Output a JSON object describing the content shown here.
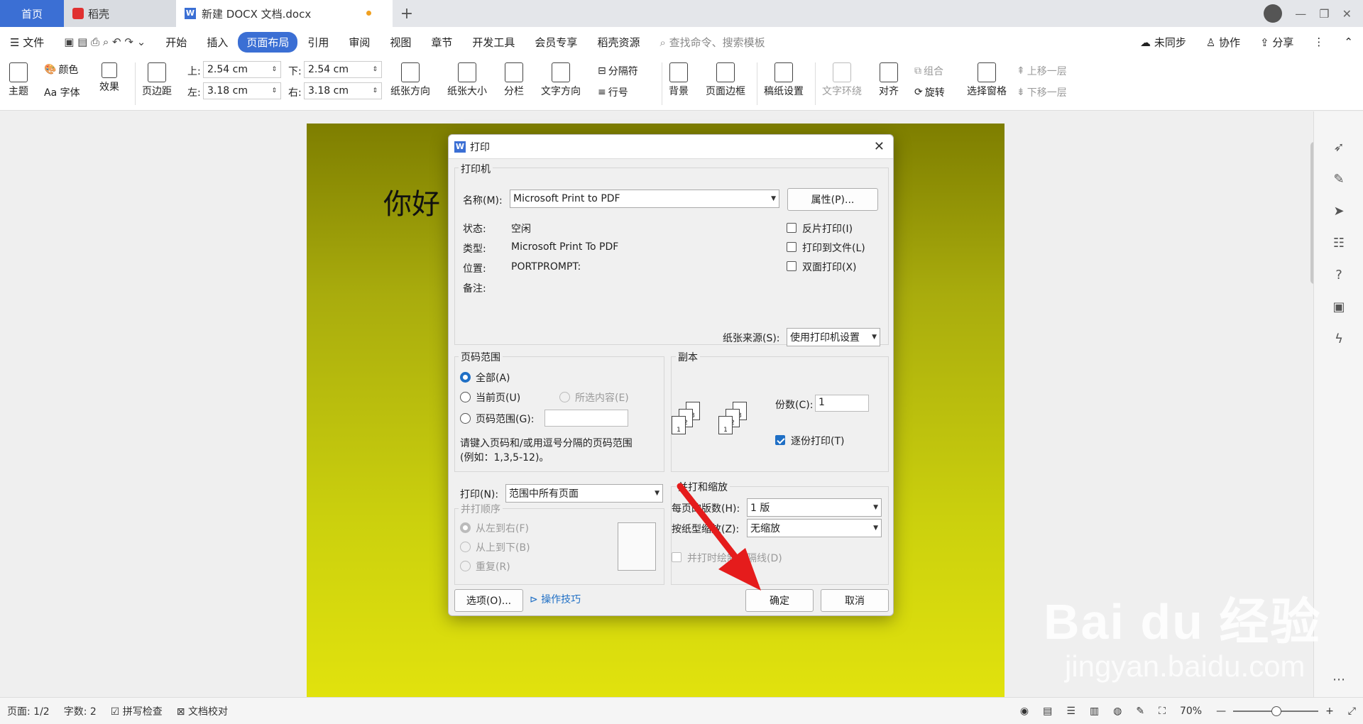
{
  "tabs": {
    "home": "首页",
    "daoke": "稻壳",
    "doc": "新建 DOCX 文档.docx",
    "plus": "+"
  },
  "menu": {
    "file": "文件",
    "items": [
      "开始",
      "插入",
      "页面布局",
      "引用",
      "审阅",
      "视图",
      "章节",
      "开发工具",
      "会员专享",
      "稻壳资源"
    ],
    "search": "查找命令、搜索模板",
    "sync": "未同步",
    "collab": "协作",
    "share": "分享"
  },
  "ribbon": {
    "theme": "主题",
    "color": "颜色",
    "font": "Aa 字体",
    "effect": "效果",
    "margin": "页边距",
    "top_label": "上:",
    "top_val": "2.54 cm",
    "bottom_label": "下:",
    "bottom_val": "2.54 cm",
    "left_label": "左:",
    "left_val": "3.18 cm",
    "right_label": "右:",
    "right_val": "3.18 cm",
    "orientation": "纸张方向",
    "size": "纸张大小",
    "columns": "分栏",
    "text_dir": "文字方向",
    "separator": "分隔符",
    "line_no": "行号",
    "background": "背景",
    "page_border": "页面边框",
    "draft": "稿纸设置",
    "wrap": "文字环绕",
    "align": "对齐",
    "group": "组合",
    "rotate": "旋转",
    "select_pane": "选择窗格",
    "up_layer": "上移一层",
    "down_layer": "下移一层"
  },
  "doc": {
    "text": "你好"
  },
  "dialog": {
    "title": "打印",
    "printer_group": "打印机",
    "name_label": "名称(M):",
    "name_val": "Microsoft Print to PDF",
    "props_btn": "属性(P)...",
    "status_label": "状态:",
    "status_val": "空闲",
    "type_label": "类型:",
    "type_val": "Microsoft Print To PDF",
    "loc_label": "位置:",
    "loc_val": "PORTPROMPT:",
    "note_label": "备注:",
    "reverse": "反片打印(I)",
    "to_file": "打印到文件(L)",
    "duplex": "双面打印(X)",
    "source_label": "纸张来源(S):",
    "source_val": "使用打印机设置",
    "range_group": "页码范围",
    "all": "全部(A)",
    "current": "当前页(U)",
    "selection": "所选内容(E)",
    "pages": "页码范围(G):",
    "hint1": "请键入页码和/或用逗号分隔的页码范围",
    "hint2": "(例如：1,3,5-12)。",
    "copies_group": "副本",
    "copies_label": "份数(C):",
    "copies_val": "1",
    "collate": "逐份打印(T)",
    "print_label": "打印(N):",
    "print_val": "范围中所有页面",
    "order_group": "并打顺序",
    "ltr": "从左到右(F)",
    "ttb": "从上到下(B)",
    "repeat": "重复(R)",
    "scale_group": "并打和缩放",
    "per_page_label": "每页的版数(H):",
    "per_page_val": "1 版",
    "scale_label": "按纸型缩放(Z):",
    "scale_val": "无缩放",
    "divider": "并打时绘制分隔线(D)",
    "options_btn": "选项(O)...",
    "tips": "操作技巧",
    "ok": "确定",
    "cancel": "取消"
  },
  "status": {
    "page": "页面: 1/2",
    "words": "字数: 2",
    "spell": "拼写检查",
    "proof": "文档校对",
    "zoom": "70%"
  },
  "watermark": {
    "main": "Bai du 经验",
    "sub": "jingyan.baidu.com"
  }
}
